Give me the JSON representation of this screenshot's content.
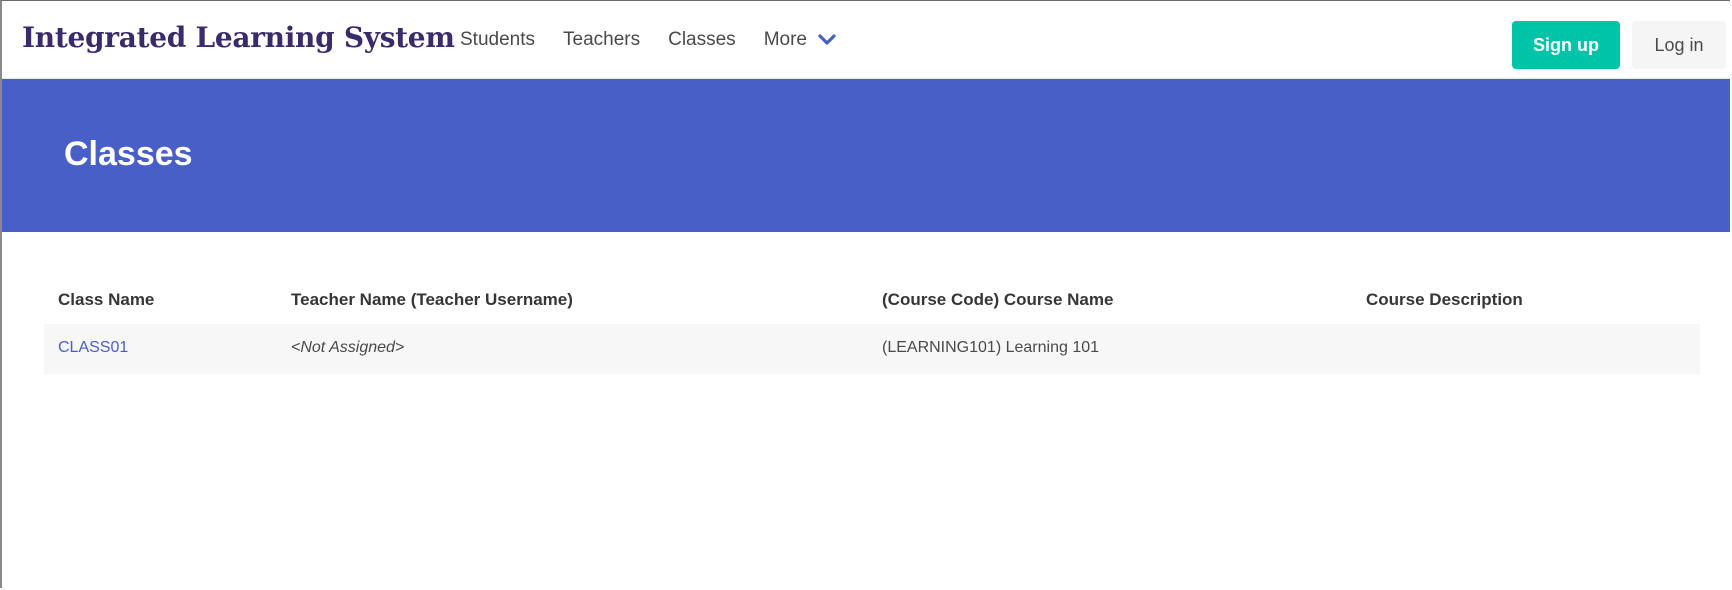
{
  "navbar": {
    "brand": "Integrated Learning System",
    "items": [
      {
        "label": "Students"
      },
      {
        "label": "Teachers"
      },
      {
        "label": "Classes"
      }
    ],
    "more_label": "More",
    "more_icon": "chevron-down-icon",
    "signup_label": "Sign up",
    "login_label": "Log in",
    "colors": {
      "brand": "#3a2b6b",
      "signup_bg": "#00c4a7",
      "login_bg": "#f5f5f5",
      "chevron": "#485fc7"
    }
  },
  "hero": {
    "title": "Classes",
    "background": "#485fc7"
  },
  "table": {
    "headers": [
      "Class Name",
      "Teacher Name (Teacher Username)",
      "(Course Code) Course Name",
      "Course Description"
    ],
    "rows": [
      {
        "class_name": "CLASS01",
        "teacher": "<Not Assigned>",
        "course": "(LEARNING101) Learning 101",
        "description": ""
      }
    ],
    "link_color": "#485fc7"
  }
}
